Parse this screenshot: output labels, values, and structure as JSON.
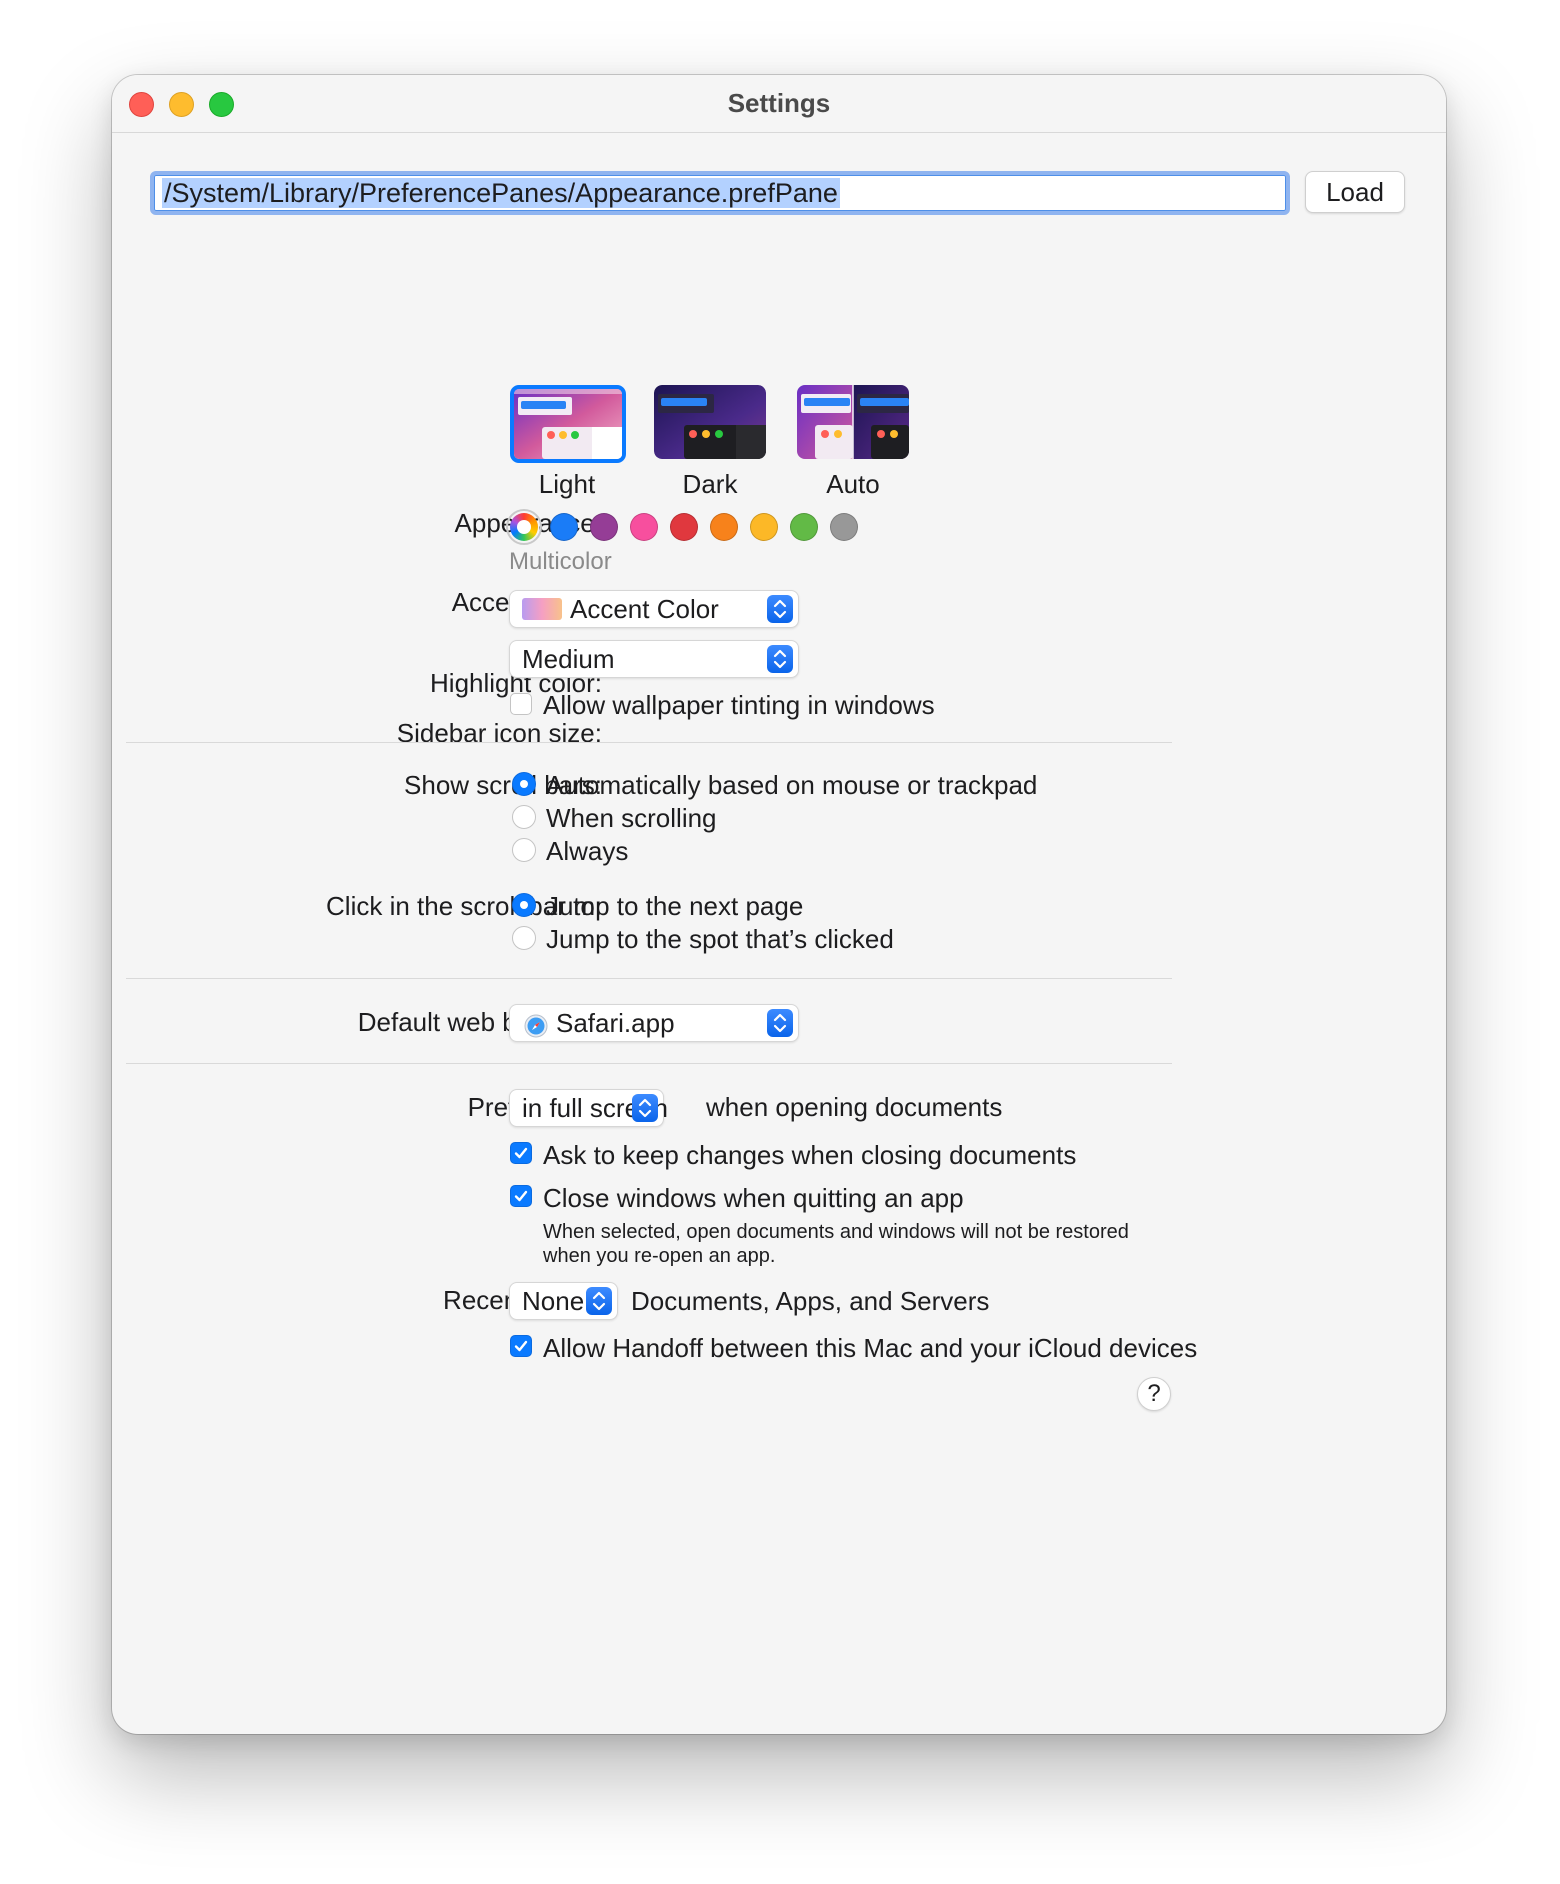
{
  "window": {
    "title": "Settings"
  },
  "toolbar": {
    "path_value": "/System/Library/PreferencePanes/Appearance.prefPane",
    "load_label": "Load"
  },
  "appearance": {
    "label": "Appearance:",
    "options": [
      {
        "label": "Light",
        "selected": true
      },
      {
        "label": "Dark",
        "selected": false
      },
      {
        "label": "Auto",
        "selected": false
      }
    ]
  },
  "accent": {
    "label": "Accent color:",
    "selected_name": "Multicolor",
    "colors": [
      "multicolor",
      "#1a7cf7",
      "#953d96",
      "#f74f9e",
      "#e0383e",
      "#f7821b",
      "#fcb827",
      "#62ba46",
      "#989898"
    ]
  },
  "highlight": {
    "label": "Highlight color:",
    "value": "Accent Color"
  },
  "sidebar_icon": {
    "label": "Sidebar icon size:",
    "value": "Medium"
  },
  "wallpaper_tinting": {
    "label": "Allow wallpaper tinting in windows",
    "checked": false
  },
  "scroll_bars": {
    "label": "Show scroll bars:",
    "options": [
      {
        "label": "Automatically based on mouse or trackpad",
        "selected": true
      },
      {
        "label": "When scrolling",
        "selected": false
      },
      {
        "label": "Always",
        "selected": false
      }
    ]
  },
  "click_scroll": {
    "label": "Click in the scroll bar to:",
    "options": [
      {
        "label": "Jump to the next page",
        "selected": true
      },
      {
        "label": "Jump to the spot that’s clicked",
        "selected": false
      }
    ]
  },
  "browser": {
    "label": "Default web browser:",
    "value": "Safari.app"
  },
  "prefer_tabs": {
    "label": "Prefer tabs:",
    "value": "in full screen",
    "suffix": "when opening documents"
  },
  "ask_keep": {
    "label": "Ask to keep changes when closing documents",
    "checked": true
  },
  "close_windows": {
    "label": "Close windows when quitting an app",
    "checked": true,
    "note": "When selected, open documents and windows will not be restored when you re-open an app."
  },
  "recent_items": {
    "label": "Recent items:",
    "value": "None",
    "suffix": "Documents, Apps, and Servers"
  },
  "handoff": {
    "label": "Allow Handoff between this Mac and your iCloud devices",
    "checked": true
  },
  "help": {
    "label": "?"
  },
  "colors": {
    "accent_blue": "#0a7aff",
    "selection": "#b3d1ff"
  }
}
